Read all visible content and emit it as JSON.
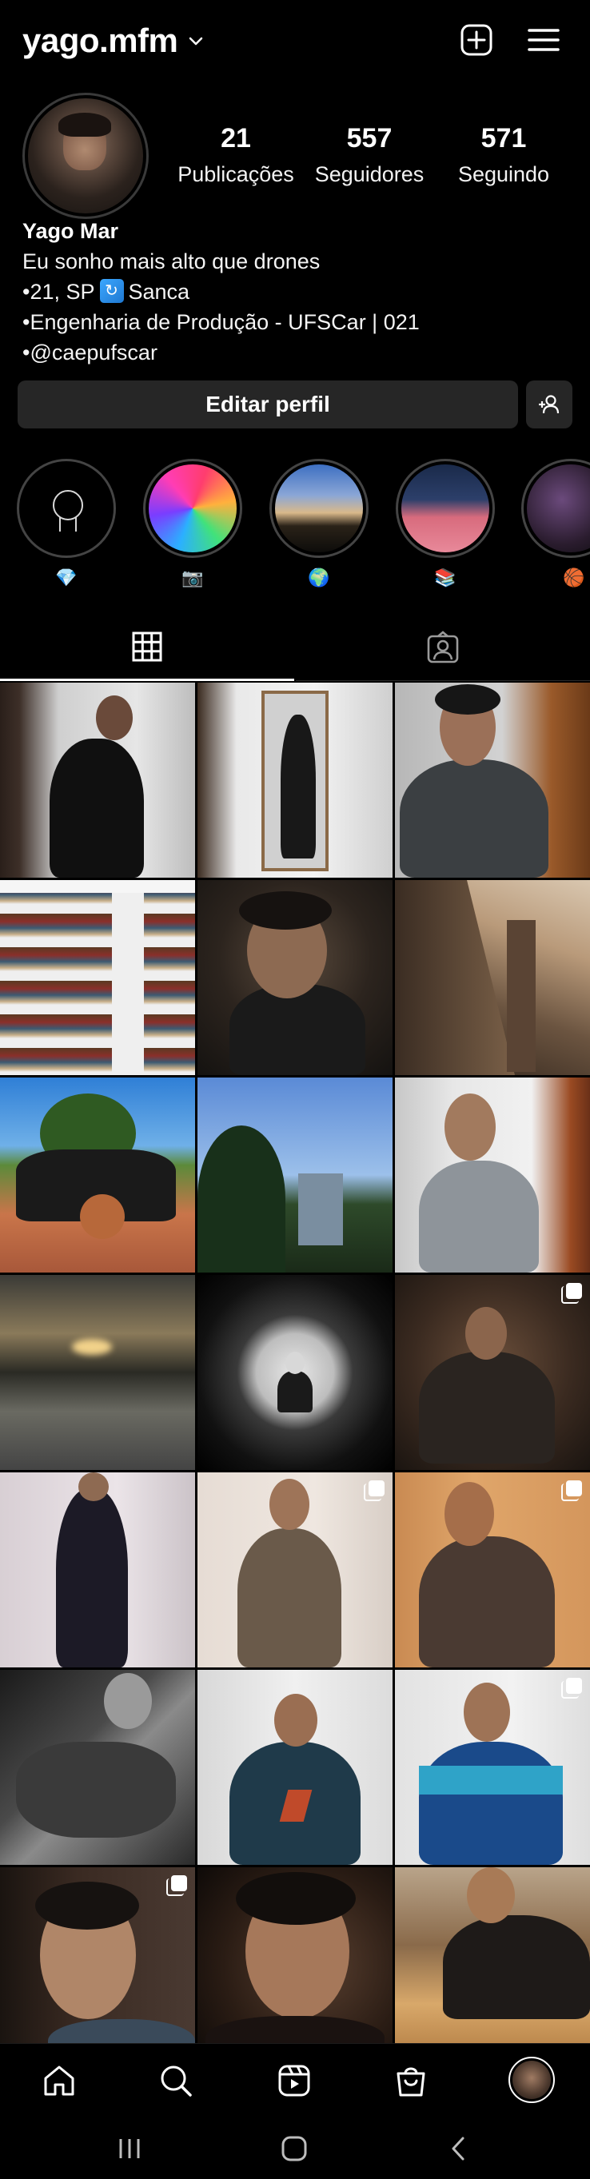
{
  "header": {
    "username": "yago.mfm",
    "icons": [
      "chevron-down-icon",
      "new-post-icon",
      "menu-icon"
    ]
  },
  "profile": {
    "stats": [
      {
        "value": "21",
        "label": "Publicações"
      },
      {
        "value": "557",
        "label": "Seguidores"
      },
      {
        "value": "571",
        "label": "Seguindo"
      }
    ],
    "name": "Yago Mar",
    "bio_lines": [
      "Eu sonho mais alto que drones",
      "•21, SP",
      "Sanca",
      "•Engenharia de Produção - UFSCar | 021",
      "•@caepufscar"
    ]
  },
  "actions": {
    "edit_label": "Editar perfil",
    "discover_icon": "add-person-icon"
  },
  "highlights": [
    {
      "emoji": "💎"
    },
    {
      "emoji": "📷"
    },
    {
      "emoji": "🌍"
    },
    {
      "emoji": "📚"
    },
    {
      "emoji": "🏀"
    }
  ],
  "tabs": [
    "grid-icon",
    "tagged-icon"
  ],
  "grid": {
    "posts": 21
  },
  "bottom_nav": [
    "home-icon",
    "search-icon",
    "reels-icon",
    "shop-icon",
    "profile-avatar"
  ],
  "system_nav": [
    "recents-icon",
    "home-button-icon",
    "back-icon"
  ]
}
